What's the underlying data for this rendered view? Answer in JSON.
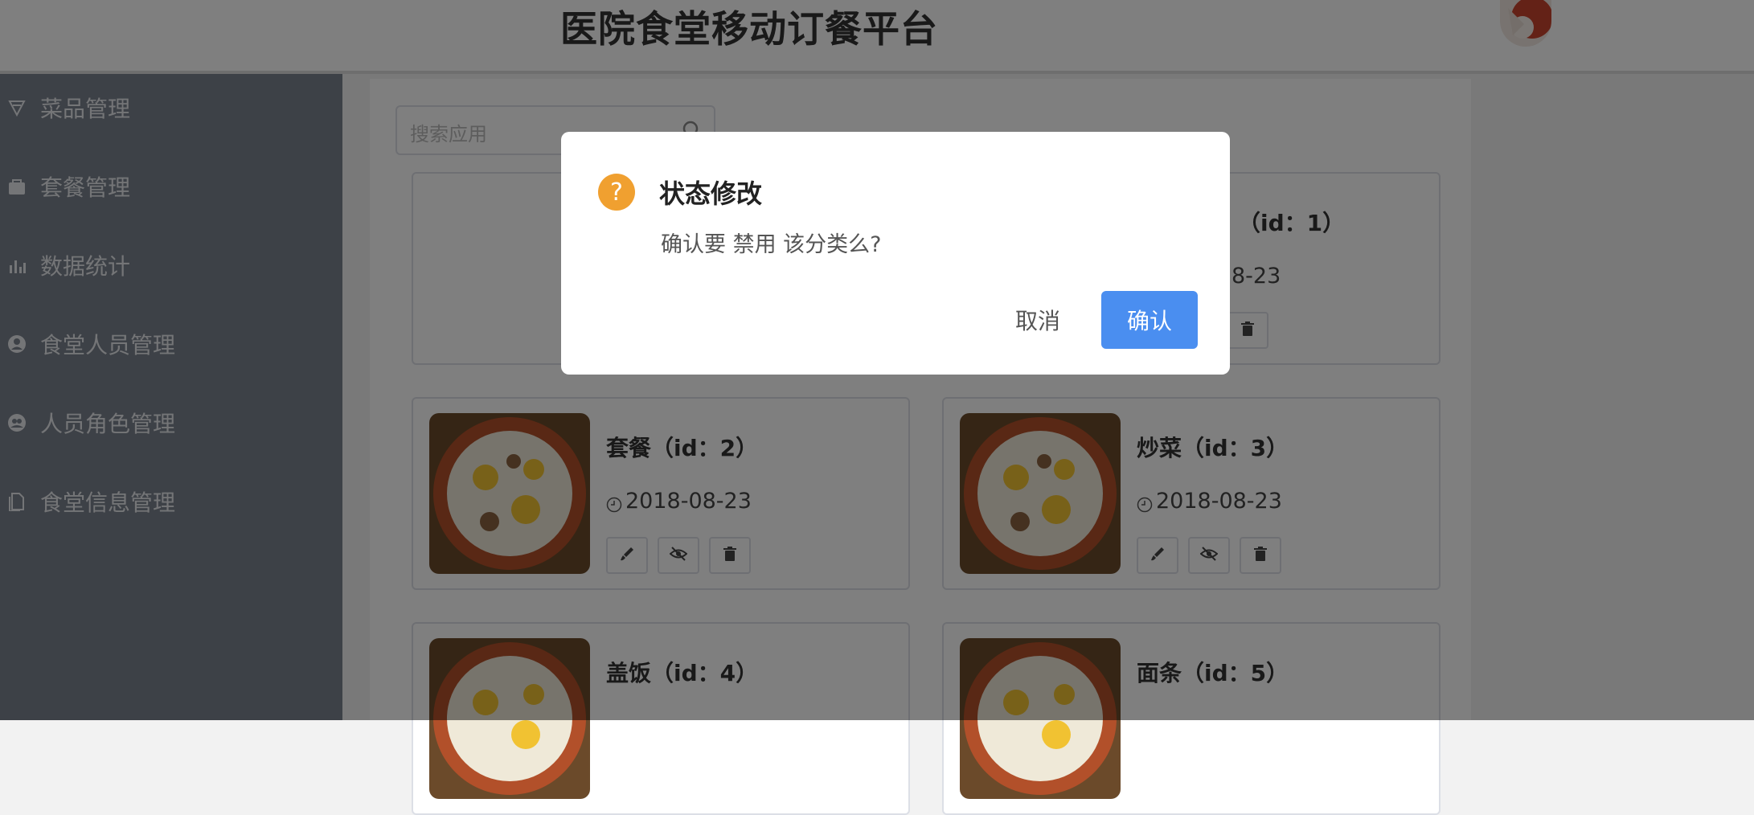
{
  "header": {
    "title": "医院食堂移动订餐平台",
    "avatar_icon": "avatar-image"
  },
  "sidebar": {
    "items": [
      {
        "label": "菜品管理",
        "icon": "menu-icon"
      },
      {
        "label": "套餐管理",
        "icon": "bag-icon"
      },
      {
        "label": "数据统计",
        "icon": "chart-icon"
      },
      {
        "label": "食堂人员管理",
        "icon": "user-icon"
      },
      {
        "label": "人员角色管理",
        "icon": "role-icon"
      },
      {
        "label": "食堂信息管理",
        "icon": "document-icon"
      }
    ]
  },
  "search": {
    "placeholder": "搜索应用"
  },
  "cards": [
    {
      "title": "（id：1）",
      "date": "8-23"
    },
    {
      "title": "套餐（id：2）",
      "date": "2018-08-23"
    },
    {
      "title": "炒菜（id：3）",
      "date": "2018-08-23"
    },
    {
      "title": "盖饭（id：4）"
    },
    {
      "title": "面条（id：5）"
    }
  ],
  "dialog": {
    "title": "状态修改",
    "message": "确认要 禁用 该分类么?",
    "icon_glyph": "?",
    "cancel_label": "取消",
    "confirm_label": "确认"
  },
  "colors": {
    "sidebar": "#7b828e",
    "primary": "#4a8ef0",
    "warning": "#f0a030"
  }
}
